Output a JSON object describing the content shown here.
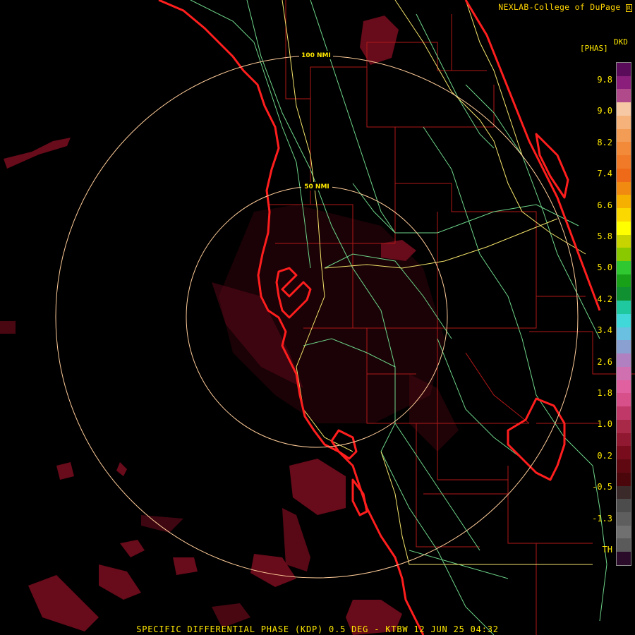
{
  "credit": "NEXLAB-College of DuPage",
  "credit_mark": "R",
  "product_code": "DKD",
  "units": "[PHAS]",
  "footer": "SPECIFIC DIFFERENTIAL PHASE (KDP) 0.5 DEG - KTBW 12 JUN 25 04:32",
  "range_rings": [
    {
      "label": "100 NMI"
    },
    {
      "label": "50 NMI"
    }
  ],
  "colorbar": {
    "labels": [
      "9.8",
      "9.0",
      "8.2",
      "7.4",
      "6.6",
      "5.8",
      "5.0",
      "4.2",
      "3.4",
      "2.6",
      "1.8",
      "1.0",
      "0.2",
      "-0.5",
      "-1.3",
      "TH"
    ],
    "colors": [
      "#5a0b5a",
      "#8a1e7a",
      "#b04a8a",
      "#f6c8a4",
      "#f5b27a",
      "#f39c56",
      "#f28a3a",
      "#f07a28",
      "#ef6a18",
      "#f08a10",
      "#f5b000",
      "#fad800",
      "#ffff00",
      "#c8d400",
      "#8ac800",
      "#30c830",
      "#18a018",
      "#109030",
      "#20c8a0",
      "#40d8d8",
      "#6ac0e0",
      "#8aa0d0",
      "#b080c0",
      "#d070b0",
      "#e060a0",
      "#d8508a",
      "#c03868",
      "#a82848",
      "#901830",
      "#780c1c",
      "#600812",
      "#4a060a",
      "#3a2a2a",
      "#4c4c4c",
      "#5e5e5e",
      "#707070",
      "#5a5a5a",
      "#2a0c2a"
    ]
  },
  "colors": {
    "coast": "#ff1e1e",
    "county": "#b01818",
    "highway": "#f4e46a",
    "road": "#6ed68a",
    "ring": "#ffcc99",
    "echo": "#6e0c1c"
  }
}
